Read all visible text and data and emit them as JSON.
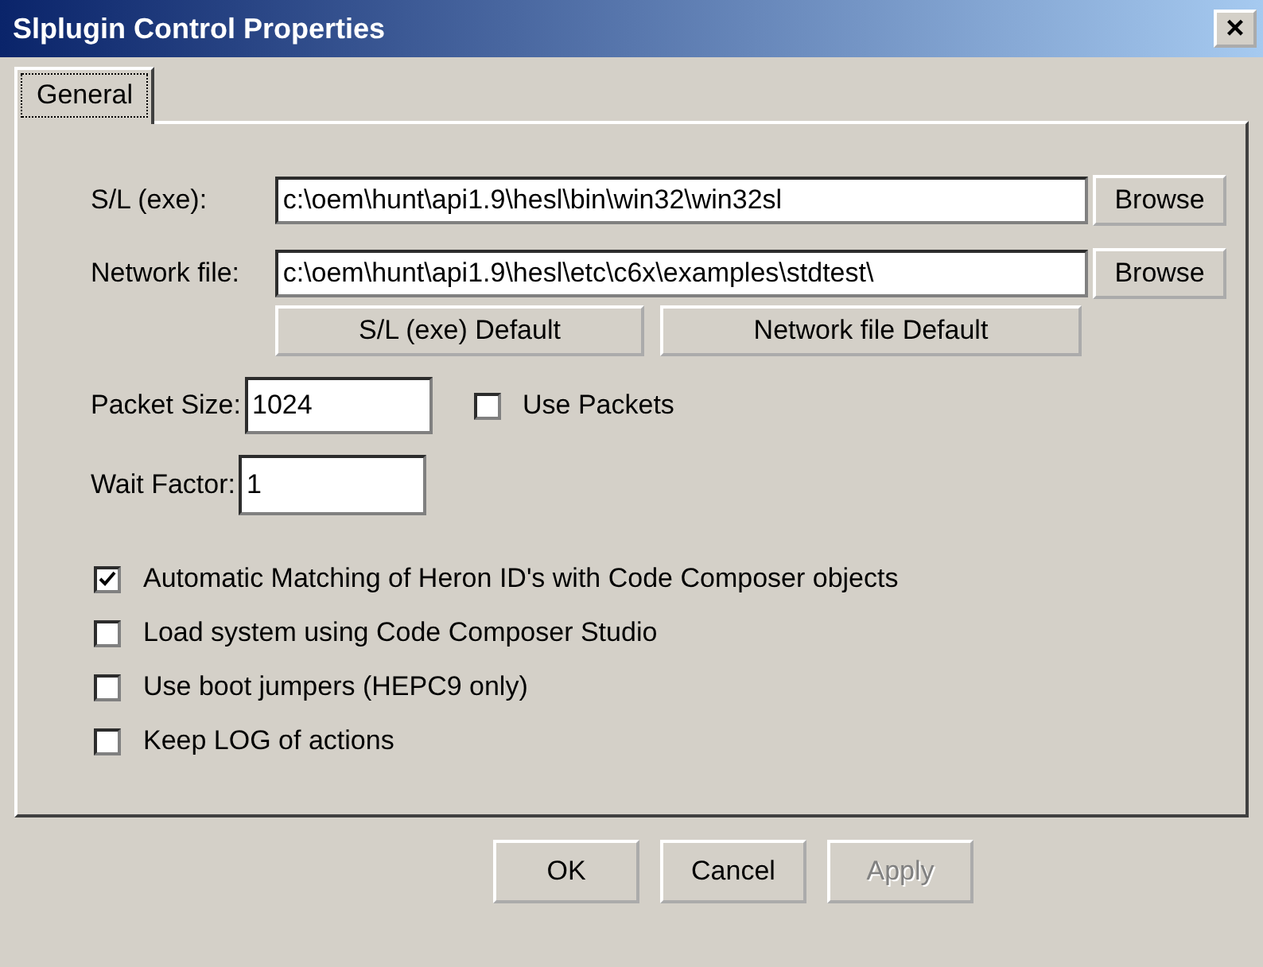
{
  "window": {
    "title": "Slplugin Control Properties",
    "close": "×"
  },
  "tabs": [
    {
      "label": "General",
      "selected": true
    }
  ],
  "fields": [
    {
      "label": "S/L (exe):",
      "value": "c:\\oem\\hunt\\api1.9\\hesl\\bin\\win32\\win32sl",
      "button": "Browse"
    },
    {
      "label": "Network file:",
      "value": "c:\\oem\\hunt\\api1.9\\hesl\\etc\\c6x\\examples\\stdtest\\",
      "button": "Browse"
    }
  ],
  "default_buttons": [
    "S/L (exe) Default",
    "Network file Default"
  ],
  "packet_size": {
    "label": "Packet Size:",
    "value": "1024"
  },
  "use_packets": {
    "label": "Use Packets",
    "checked": false
  },
  "wait_factor": {
    "label": "Wait Factor:",
    "value": "1"
  },
  "options": [
    {
      "label": "Automatic Matching of Heron ID's with Code Composer objects",
      "checked": true
    },
    {
      "label": "Load system using Code Composer Studio",
      "checked": false
    },
    {
      "label": "Use boot jumpers (HEPC9 only)",
      "checked": false
    },
    {
      "label": "Keep LOG of actions",
      "checked": false
    }
  ],
  "buttons": [
    {
      "label": "OK",
      "disabled": false
    },
    {
      "label": "Cancel",
      "disabled": false
    },
    {
      "label": "Apply",
      "disabled": true
    }
  ]
}
